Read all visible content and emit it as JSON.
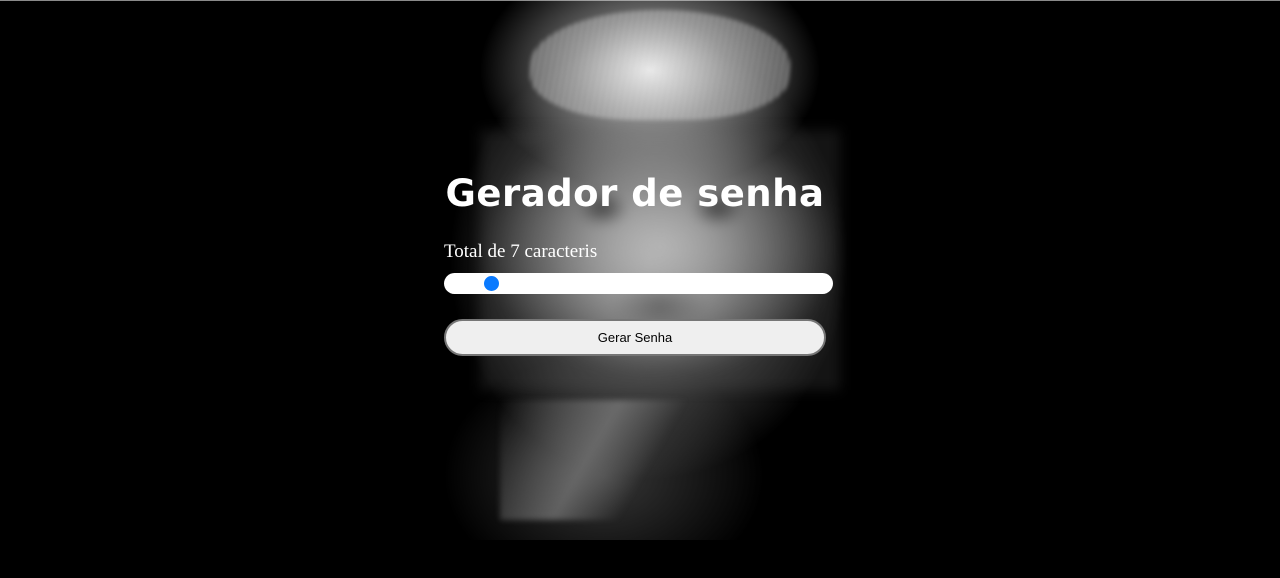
{
  "page": {
    "title": "Gerador de senha"
  },
  "password_length": {
    "prefix": "Total de ",
    "value": "7",
    "suffix": " caracteris",
    "slider_level": 0.1
  },
  "actions": {
    "generate_label": "Gerar Senha"
  },
  "colors": {
    "background": "#000000",
    "slider_thumb": "#0a7aff",
    "text": "#ffffff",
    "button_bg": "#efefef"
  }
}
